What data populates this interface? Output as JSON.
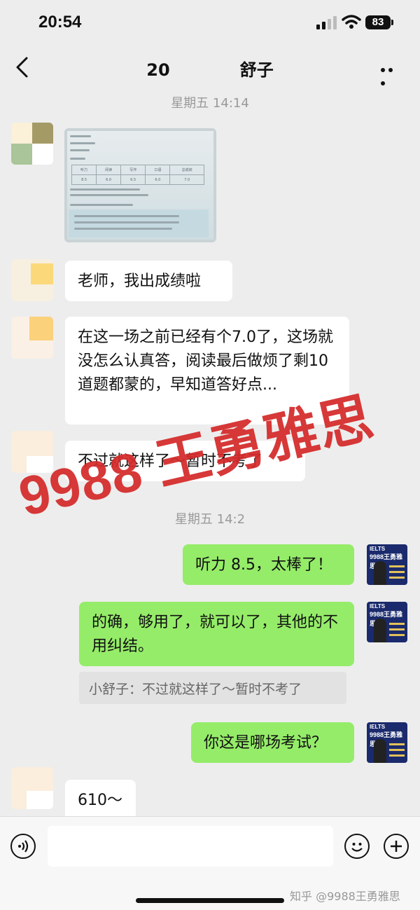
{
  "status_bar": {
    "time": "20:54",
    "battery": "83"
  },
  "header": {
    "title_prefix": "20",
    "title_suffix": "舒子"
  },
  "chat": {
    "timestamp_1": "星期五 14:14",
    "photo": {
      "cols": [
        "听力",
        "阅读",
        "写作",
        "口语",
        "总成绩"
      ],
      "scores": [
        "8.5",
        "6.0",
        "6.5",
        "6.0",
        "7.0"
      ]
    },
    "msg_1": "老师，我出成绩啦",
    "msg_2": "在这一场之前已经有个7.0了，这场就没怎么认真答，阅读最后做烦了剩10道题都蒙的，早知道答好点...",
    "msg_3": "不过就这样了～暂时不考了",
    "timestamp_2": "星期五 14:2",
    "msg_4": "听力 8.5，太棒了！",
    "msg_5": "的确，够用了，就可以了，其他的不用纠结。",
    "quote": "小舒子：不过就这样了～暂时不考了",
    "msg_6": "你这是哪场考试？",
    "msg_7": "610～"
  },
  "teacher_avatar": {
    "brand": "IELTS",
    "name": "9988王勇雅思"
  },
  "watermark": "9988 王勇雅思",
  "credit": "知乎 @9988王勇雅思",
  "colors": {
    "sent_bubble": "#95ec69",
    "received_bubble": "#ffffff",
    "background": "#ededed",
    "watermark": "#d52a2a"
  }
}
